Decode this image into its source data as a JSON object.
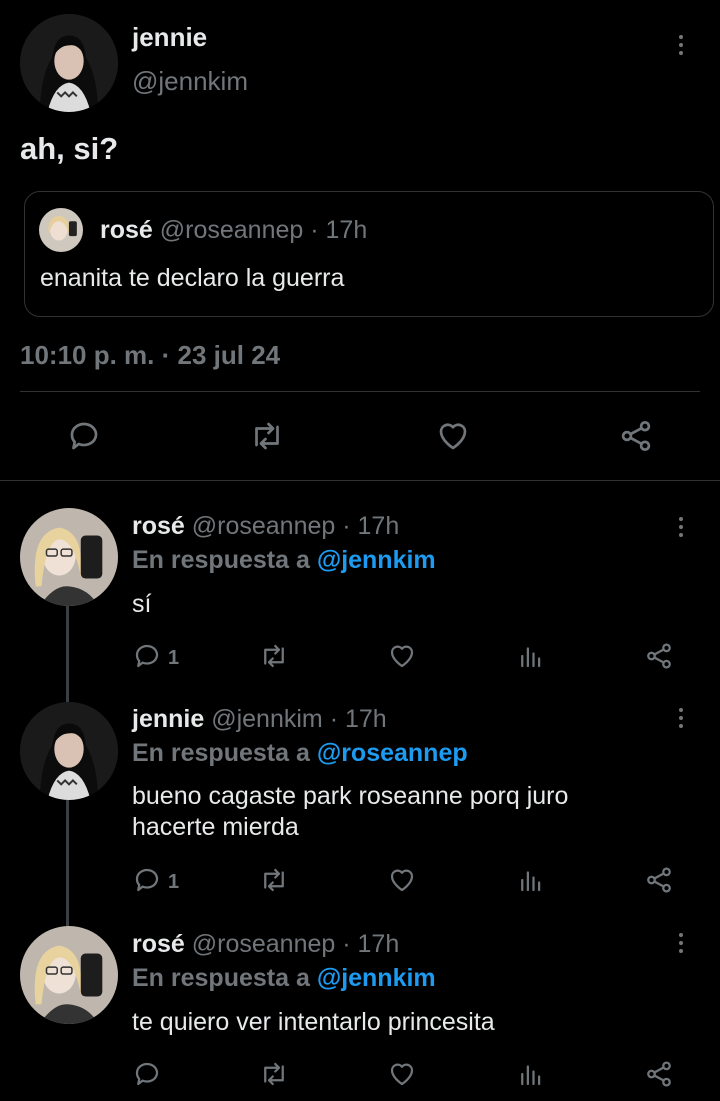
{
  "main_tweet": {
    "author_name": "jennie",
    "author_handle": "@jennkim",
    "text": "ah, si?",
    "quote": {
      "author_name": "rosé",
      "author_handle": "@roseannep",
      "time": "· 17h",
      "text": "enanita te declaro la guerra"
    },
    "timestamp": "10:10 p. m. · 23 jul 24"
  },
  "replies": [
    {
      "author_name": "rosé",
      "author_handle": "@roseannep",
      "time": "· 17h",
      "reply_prefix": "En respuesta a",
      "reply_to": "@jennkim",
      "text": "sí",
      "reply_count": "1"
    },
    {
      "author_name": "jennie",
      "author_handle": "@jennkim",
      "time": "· 17h",
      "reply_prefix": "En respuesta a",
      "reply_to": "@roseannep",
      "text_line1": "bueno cagaste park roseanne porq juro",
      "text_line2": "hacerte mierda",
      "reply_count": "1"
    },
    {
      "author_name": "rosé",
      "author_handle": "@roseannep",
      "time": "· 17h",
      "reply_prefix": "En respuesta a",
      "reply_to": "@jennkim",
      "text": "te quiero ver intentarlo princesita",
      "reply_count": ""
    }
  ],
  "colors": {
    "background": "#000000",
    "text": "#e7e9ea",
    "muted": "#71767b",
    "link": "#1d9bf0",
    "border": "#2f3336"
  },
  "icons": [
    "reply-icon",
    "retweet-icon",
    "like-icon",
    "share-icon",
    "views-icon",
    "more-icon"
  ]
}
